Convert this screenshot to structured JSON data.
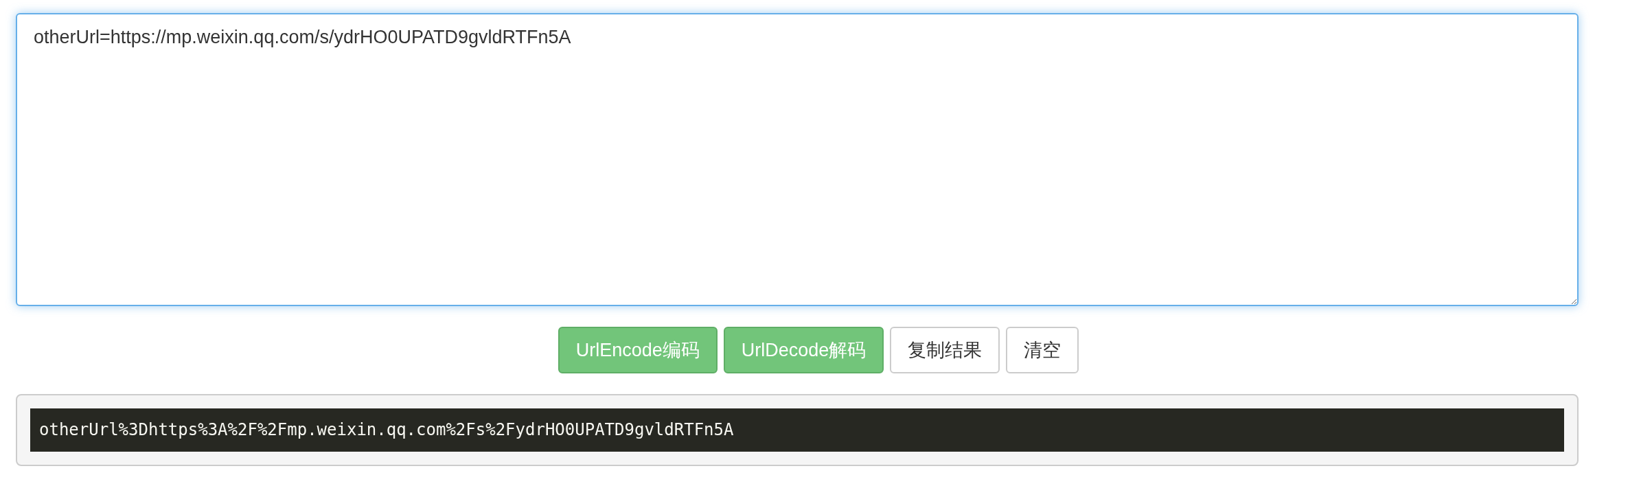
{
  "input": {
    "value": "otherUrl=https://mp.weixin.qq.com/s/ydrHO0UPATD9gvldRTFn5A",
    "focused": true
  },
  "buttons": [
    {
      "label": "UrlEncode编码",
      "kind": "primary"
    },
    {
      "label": "UrlDecode解码",
      "kind": "primary"
    },
    {
      "label": "复制结果",
      "kind": "default"
    },
    {
      "label": "清空",
      "kind": "default"
    }
  ],
  "result": {
    "text": "otherUrl%3Dhttps%3A%2F%2Fmp.weixin.qq.com%2Fs%2FydrHO0UPATD9gvldRTFn5A"
  }
}
